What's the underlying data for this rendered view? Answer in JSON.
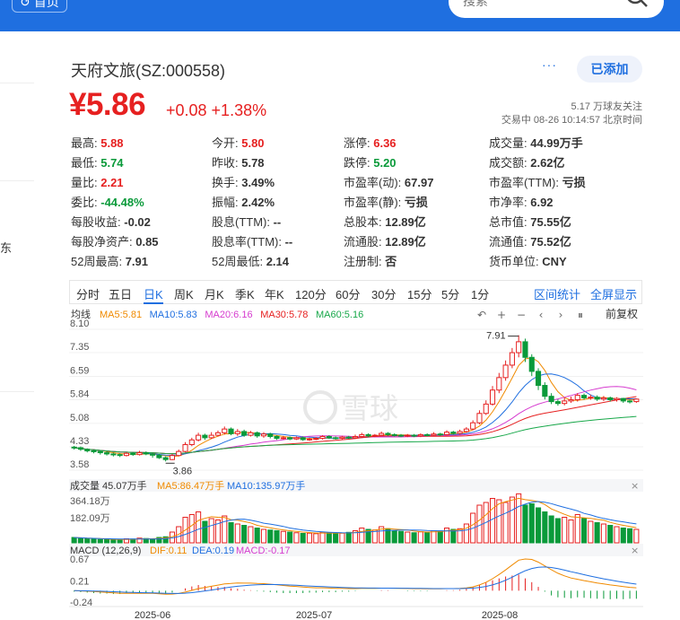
{
  "topbar": {
    "home_label": "首页",
    "search_placeholder": "搜索"
  },
  "left": {
    "side_char": "东"
  },
  "stock": {
    "name": "天府文旅(SZ:000558)",
    "price": "¥5.86",
    "change": "+0.08 +1.38%",
    "followers": "5.17 万球友关注",
    "trade_time": "交易中 08-26 10:14:57 北京时间",
    "follow_label": "已添加",
    "more": "···"
  },
  "quote": [
    [
      {
        "l": "最高:",
        "v": "5.88",
        "c": "red"
      },
      {
        "l": "今开:",
        "v": "5.80",
        "c": "red"
      },
      {
        "l": "涨停:",
        "v": "6.36",
        "c": "red"
      },
      {
        "l": "成交量:",
        "v": "44.99万手",
        "c": ""
      }
    ],
    [
      {
        "l": "最低:",
        "v": "5.74",
        "c": "green"
      },
      {
        "l": "昨收:",
        "v": "5.78",
        "c": ""
      },
      {
        "l": "跌停:",
        "v": "5.20",
        "c": "green"
      },
      {
        "l": "成交额:",
        "v": "2.62亿",
        "c": ""
      }
    ],
    [
      {
        "l": "量比:",
        "v": "2.21",
        "c": "red"
      },
      {
        "l": "换手:",
        "v": "3.49%",
        "c": ""
      },
      {
        "l": "市盈率(动):",
        "v": "67.97",
        "c": ""
      },
      {
        "l": "市盈率(TTM):",
        "v": "亏损",
        "c": ""
      }
    ],
    [
      {
        "l": "委比:",
        "v": "-44.48%",
        "c": "green"
      },
      {
        "l": "振幅:",
        "v": "2.42%",
        "c": ""
      },
      {
        "l": "市盈率(静):",
        "v": "亏损",
        "c": ""
      },
      {
        "l": "市净率:",
        "v": "6.92",
        "c": ""
      }
    ],
    [
      {
        "l": "每股收益:",
        "v": "-0.02",
        "c": ""
      },
      {
        "l": "股息(TTM):",
        "v": "--",
        "c": ""
      },
      {
        "l": "总股本:",
        "v": "12.89亿",
        "c": ""
      },
      {
        "l": "总市值:",
        "v": "75.55亿",
        "c": ""
      }
    ],
    [
      {
        "l": "每股净资产:",
        "v": "0.85",
        "c": ""
      },
      {
        "l": "股息率(TTM):",
        "v": "--",
        "c": ""
      },
      {
        "l": "流通股:",
        "v": "12.89亿",
        "c": ""
      },
      {
        "l": "流通值:",
        "v": "75.52亿",
        "c": ""
      }
    ],
    [
      {
        "l": "52周最高:",
        "v": "7.91",
        "c": ""
      },
      {
        "l": "52周最低:",
        "v": "2.14",
        "c": ""
      },
      {
        "l": "注册制:",
        "v": "否",
        "c": ""
      },
      {
        "l": "货币单位:",
        "v": "CNY",
        "c": ""
      }
    ]
  ],
  "tabs": [
    "分时",
    "五日",
    "日K",
    "周K",
    "月K",
    "季K",
    "年K",
    "120分",
    "60分",
    "30分",
    "15分",
    "5分",
    "1分"
  ],
  "active_tab": "日K",
  "tab_links": [
    "区间统计",
    "全屏显示"
  ],
  "chart_data": {
    "type": "candlestick",
    "ma_legend": {
      "label": "均线",
      "items": [
        {
          "name": "MA5",
          "value": "5.81",
          "color": "#f08a00"
        },
        {
          "name": "MA10",
          "value": "5.83",
          "color": "#1f6fe0"
        },
        {
          "name": "MA20",
          "value": "6.16",
          "color": "#d63ccf"
        },
        {
          "name": "MA30",
          "value": "5.78",
          "color": "#e62020"
        },
        {
          "name": "MA60",
          "value": "5.16",
          "color": "#18a84a"
        }
      ]
    },
    "price_ticks": [
      "8.10",
      "7.35",
      "6.59",
      "5.84",
      "5.08",
      "4.33",
      "3.58"
    ],
    "ylim": [
      3.58,
      8.1
    ],
    "high_marker": "7.91",
    "low_marker": "3.86",
    "watermark": "雪球",
    "toolbar": [
      "↶",
      "+",
      "−",
      "‹",
      "›",
      "⏸"
    ],
    "adjust": "前复权",
    "volume": {
      "label": "成交量 45.07万手",
      "ma5": "MA5:86.47万手",
      "ma10": "MA10:135.97万手",
      "ticks": [
        "364.18万",
        "182.09万"
      ],
      "ylim": [
        0,
        400
      ]
    },
    "macd": {
      "label": "MACD (12,26,9)",
      "dif": "DIF:0.11",
      "dea": "DEA:0.19",
      "macd": "MACD:-0.17",
      "ticks": [
        "0.67",
        "0.21",
        "-0.24"
      ],
      "ylim": [
        -0.24,
        0.67
      ]
    },
    "dates": [
      "2025-06",
      "2025-07",
      "2025-08"
    ],
    "candles": [
      [
        4.32,
        4.3,
        4.36,
        4.24
      ],
      [
        4.3,
        4.25,
        4.34,
        4.2
      ],
      [
        4.25,
        4.2,
        4.28,
        4.15
      ],
      [
        4.2,
        4.18,
        4.24,
        4.12
      ],
      [
        4.18,
        4.14,
        4.22,
        4.08
      ],
      [
        4.14,
        4.1,
        4.18,
        4.05
      ],
      [
        4.1,
        4.08,
        4.14,
        4.02
      ],
      [
        4.08,
        4.05,
        4.12,
        4.0
      ],
      [
        4.05,
        4.12,
        4.16,
        4.02
      ],
      [
        4.12,
        4.08,
        4.16,
        4.04
      ],
      [
        4.08,
        4.14,
        4.2,
        4.05
      ],
      [
        4.14,
        4.1,
        4.18,
        4.06
      ],
      [
        4.1,
        4.06,
        4.14,
        3.98
      ],
      [
        4.06,
        3.98,
        4.1,
        3.94
      ],
      [
        3.98,
        3.92,
        4.02,
        3.86
      ],
      [
        3.92,
        4.05,
        4.1,
        3.9
      ],
      [
        4.05,
        4.18,
        4.24,
        4.02
      ],
      [
        4.18,
        4.4,
        4.48,
        4.15
      ],
      [
        4.4,
        4.55,
        4.62,
        4.35
      ],
      [
        4.55,
        4.7,
        4.78,
        4.5
      ],
      [
        4.7,
        4.62,
        4.75,
        4.55
      ],
      [
        4.62,
        4.7,
        4.8,
        4.58
      ],
      [
        4.7,
        4.78,
        4.85,
        4.66
      ],
      [
        4.78,
        4.9,
        4.98,
        4.72
      ],
      [
        4.9,
        4.75,
        4.95,
        4.7
      ],
      [
        4.75,
        4.82,
        4.9,
        4.68
      ],
      [
        4.82,
        4.7,
        4.88,
        4.65
      ],
      [
        4.7,
        4.78,
        4.84,
        4.66
      ],
      [
        4.78,
        4.68,
        4.82,
        4.62
      ],
      [
        4.68,
        4.74,
        4.8,
        4.62
      ],
      [
        4.74,
        4.66,
        4.78,
        4.6
      ],
      [
        4.66,
        4.6,
        4.7,
        4.55
      ],
      [
        4.6,
        4.62,
        4.68,
        4.56
      ],
      [
        4.62,
        4.58,
        4.66,
        4.54
      ],
      [
        4.58,
        4.62,
        4.66,
        4.55
      ],
      [
        4.62,
        4.56,
        4.66,
        4.52
      ],
      [
        4.56,
        4.58,
        4.62,
        4.52
      ],
      [
        4.58,
        4.6,
        4.64,
        4.54
      ],
      [
        4.6,
        4.66,
        4.7,
        4.56
      ],
      [
        4.66,
        4.62,
        4.7,
        4.58
      ],
      [
        4.62,
        4.6,
        4.66,
        4.56
      ],
      [
        4.6,
        4.64,
        4.68,
        4.56
      ],
      [
        4.64,
        4.62,
        4.68,
        4.58
      ],
      [
        4.62,
        4.66,
        4.72,
        4.58
      ],
      [
        4.66,
        4.72,
        4.78,
        4.62
      ],
      [
        4.72,
        4.68,
        4.76,
        4.64
      ],
      [
        4.68,
        4.7,
        4.74,
        4.64
      ],
      [
        4.7,
        4.76,
        4.82,
        4.66
      ],
      [
        4.76,
        4.72,
        4.8,
        4.68
      ],
      [
        4.72,
        4.7,
        4.76,
        4.66
      ],
      [
        4.7,
        4.68,
        4.74,
        4.64
      ],
      [
        4.68,
        4.7,
        4.74,
        4.64
      ],
      [
        4.7,
        4.68,
        4.74,
        4.64
      ],
      [
        4.68,
        4.72,
        4.76,
        4.64
      ],
      [
        4.72,
        4.7,
        4.76,
        4.66
      ],
      [
        4.7,
        4.74,
        4.8,
        4.66
      ],
      [
        4.74,
        4.72,
        4.78,
        4.68
      ],
      [
        4.72,
        4.8,
        4.86,
        4.7
      ],
      [
        4.8,
        4.76,
        4.84,
        4.72
      ],
      [
        4.76,
        4.82,
        4.88,
        4.72
      ],
      [
        4.82,
        4.9,
        4.96,
        4.78
      ],
      [
        4.9,
        5.1,
        5.18,
        4.86
      ],
      [
        5.1,
        5.4,
        5.5,
        5.05
      ],
      [
        5.4,
        5.7,
        5.82,
        5.35
      ],
      [
        5.7,
        6.15,
        6.28,
        5.65
      ],
      [
        6.15,
        6.55,
        6.7,
        6.05
      ],
      [
        6.55,
        6.95,
        7.1,
        6.45
      ],
      [
        6.95,
        7.35,
        7.5,
        6.85
      ],
      [
        7.35,
        7.7,
        7.91,
        7.2
      ],
      [
        7.7,
        7.2,
        7.8,
        7.05
      ],
      [
        7.2,
        6.75,
        7.3,
        6.6
      ],
      [
        6.75,
        6.3,
        6.85,
        6.15
      ],
      [
        6.3,
        5.95,
        6.4,
        5.85
      ],
      [
        5.95,
        5.78,
        6.05,
        5.7
      ],
      [
        5.78,
        5.72,
        5.85,
        5.65
      ],
      [
        5.72,
        5.8,
        5.9,
        5.66
      ],
      [
        5.8,
        5.84,
        5.94,
        5.74
      ],
      [
        5.84,
        5.98,
        6.05,
        5.78
      ],
      [
        5.98,
        5.9,
        6.04,
        5.84
      ],
      [
        5.9,
        5.92,
        6.0,
        5.84
      ],
      [
        5.92,
        5.86,
        5.98,
        5.8
      ],
      [
        5.86,
        5.9,
        5.96,
        5.8
      ],
      [
        5.9,
        5.84,
        5.94,
        5.78
      ],
      [
        5.84,
        5.88,
        5.92,
        5.78
      ],
      [
        5.88,
        5.8,
        5.9,
        5.74
      ],
      [
        5.8,
        5.78,
        5.84,
        5.72
      ],
      [
        5.78,
        5.86,
        5.88,
        5.74
      ]
    ],
    "volumes": [
      40,
      35,
      30,
      28,
      25,
      26,
      22,
      24,
      30,
      28,
      35,
      32,
      30,
      40,
      45,
      80,
      120,
      190,
      210,
      230,
      160,
      180,
      170,
      200,
      150,
      140,
      130,
      120,
      110,
      100,
      95,
      90,
      85,
      80,
      75,
      70,
      72,
      68,
      80,
      75,
      70,
      72,
      78,
      90,
      110,
      100,
      95,
      120,
      105,
      90,
      85,
      80,
      75,
      82,
      78,
      90,
      88,
      110,
      100,
      105,
      140,
      220,
      280,
      300,
      330,
      320,
      300,
      340,
      364,
      280,
      290,
      260,
      230,
      200,
      180,
      190,
      170,
      210,
      180,
      160,
      150,
      140,
      130,
      120,
      110,
      105,
      100
    ],
    "macd_hist": [
      -0.02,
      -0.03,
      -0.04,
      -0.05,
      -0.06,
      -0.06,
      -0.07,
      -0.07,
      -0.06,
      -0.05,
      -0.04,
      -0.04,
      -0.05,
      -0.06,
      -0.07,
      -0.04,
      0.0,
      0.05,
      0.09,
      0.12,
      0.1,
      0.09,
      0.08,
      0.08,
      0.05,
      0.04,
      0.02,
      0.01,
      -0.01,
      -0.02,
      -0.03,
      -0.04,
      -0.05,
      -0.05,
      -0.05,
      -0.05,
      -0.04,
      -0.04,
      -0.03,
      -0.03,
      -0.03,
      -0.02,
      -0.02,
      -0.01,
      0.0,
      0.0,
      0.0,
      0.01,
      0.01,
      0.0,
      0.0,
      -0.01,
      -0.01,
      -0.01,
      -0.01,
      0.0,
      0.0,
      0.01,
      0.01,
      0.02,
      0.04,
      0.08,
      0.12,
      0.17,
      0.22,
      0.26,
      0.3,
      0.32,
      0.34,
      0.26,
      0.18,
      0.08,
      -0.02,
      -0.1,
      -0.14,
      -0.15,
      -0.16,
      -0.14,
      -0.15,
      -0.16,
      -0.17,
      -0.17,
      -0.18,
      -0.17,
      -0.18,
      -0.17,
      -0.17
    ]
  }
}
